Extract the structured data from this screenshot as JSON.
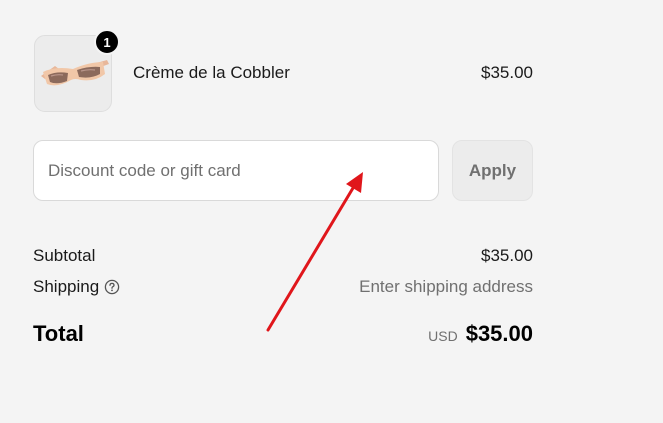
{
  "product": {
    "name": "Crème de la Cobbler",
    "price": "$35.00",
    "quantity": "1",
    "image_icon": "sunglasses-icon"
  },
  "discount": {
    "placeholder": "Discount code or gift card",
    "apply_label": "Apply"
  },
  "summary": {
    "subtotal_label": "Subtotal",
    "subtotal_value": "$35.00",
    "shipping_label": "Shipping",
    "shipping_value": "Enter shipping address",
    "total_label": "Total",
    "currency": "USD",
    "total_value": "$35.00"
  },
  "colors": {
    "background": "#f4f4f4",
    "annotation_arrow": "#e0161b",
    "badge": "#000000"
  }
}
